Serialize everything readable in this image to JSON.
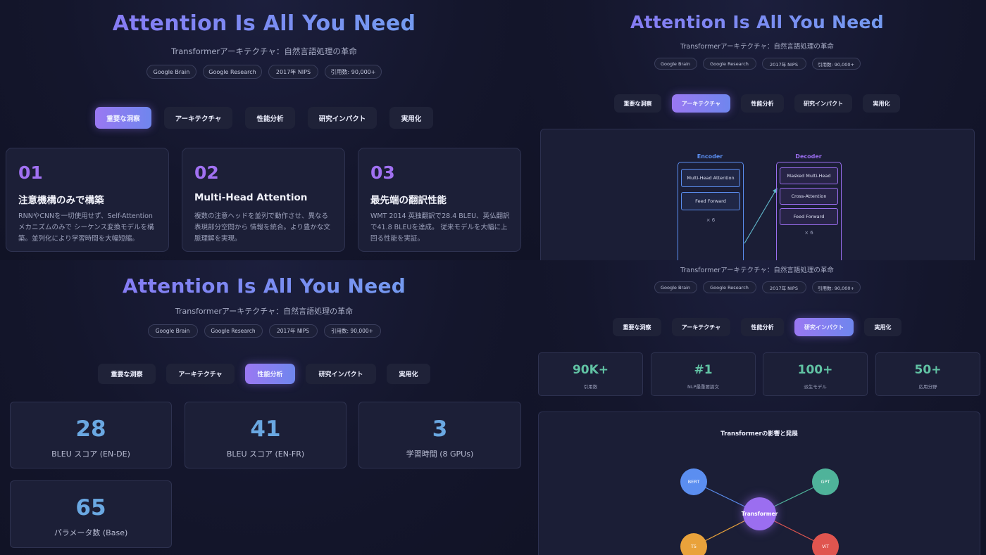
{
  "header": {
    "title": "Attention Is All You Need",
    "subtitle": "Transformerアーキテクチャ：自然言語処理の革命",
    "badges": [
      "Google Brain",
      "Google Research",
      "2017年 NIPS",
      "引用数: 90,000+"
    ]
  },
  "tabs": [
    "重要な洞察",
    "アーキテクチャ",
    "性能分析",
    "研究インパクト",
    "実用化"
  ],
  "insights": [
    {
      "num": "01",
      "title": "注意機構のみで構築",
      "desc": "RNNやCNNを一切使用せず、Self-Attentionメカニズムのみで シーケンス変換モデルを構築。並列化により学習時間を大幅短縮。"
    },
    {
      "num": "02",
      "title": "Multi-Head Attention",
      "desc": "複数の注意ヘッドを並列で動作させ、異なる表現部分空間から 情報を統合。より豊かな文脈理解を実現。"
    },
    {
      "num": "03",
      "title": "最先端の翻訳性能",
      "desc": "WMT 2014 英独翻訳で28.4 BLEU、英仏翻訳で41.8 BLEUを達成。 従来モデルを大幅に上回る性能を実証。"
    }
  ],
  "architecture": {
    "encoder": {
      "label": "Encoder",
      "items": [
        "Multi-Head Attention",
        "Feed Forward"
      ],
      "times": "× 6"
    },
    "decoder": {
      "label": "Decoder",
      "items": [
        "Masked Multi-Head",
        "Cross-Attention",
        "Feed Forward"
      ],
      "times": "× 6"
    }
  },
  "performance": [
    {
      "value": "28",
      "label": "BLEU スコア (EN-DE)"
    },
    {
      "value": "41",
      "label": "BLEU スコア (EN-FR)"
    },
    {
      "value": "3",
      "label": "学習時間 (8 GPUs)"
    },
    {
      "value": "65",
      "label": "パラメータ数 (Base)"
    }
  ],
  "impact": {
    "stats": [
      {
        "value": "90K+",
        "label": "引用数"
      },
      {
        "value": "#1",
        "label": "NLP最重要論文"
      },
      {
        "value": "100+",
        "label": "派生モデル"
      },
      {
        "value": "50+",
        "label": "応用分野"
      }
    ],
    "diagram_title": "Transformerの影響と発展",
    "center": "Transformer",
    "nodes": [
      "BERT",
      "GPT",
      "T5",
      "ViT"
    ]
  },
  "colors": {
    "accent_purple": "#a171f2",
    "accent_blue": "#6fa6ef",
    "stat_blue": "#6aa8e2",
    "impact_green": "#61c3a4",
    "encoder": "#5b8ef0",
    "decoder": "#9b6ef0",
    "node_bert": "#5b8ef0",
    "node_gpt": "#4fb39a",
    "node_t5": "#e9a23b",
    "node_vit": "#e0554f"
  }
}
